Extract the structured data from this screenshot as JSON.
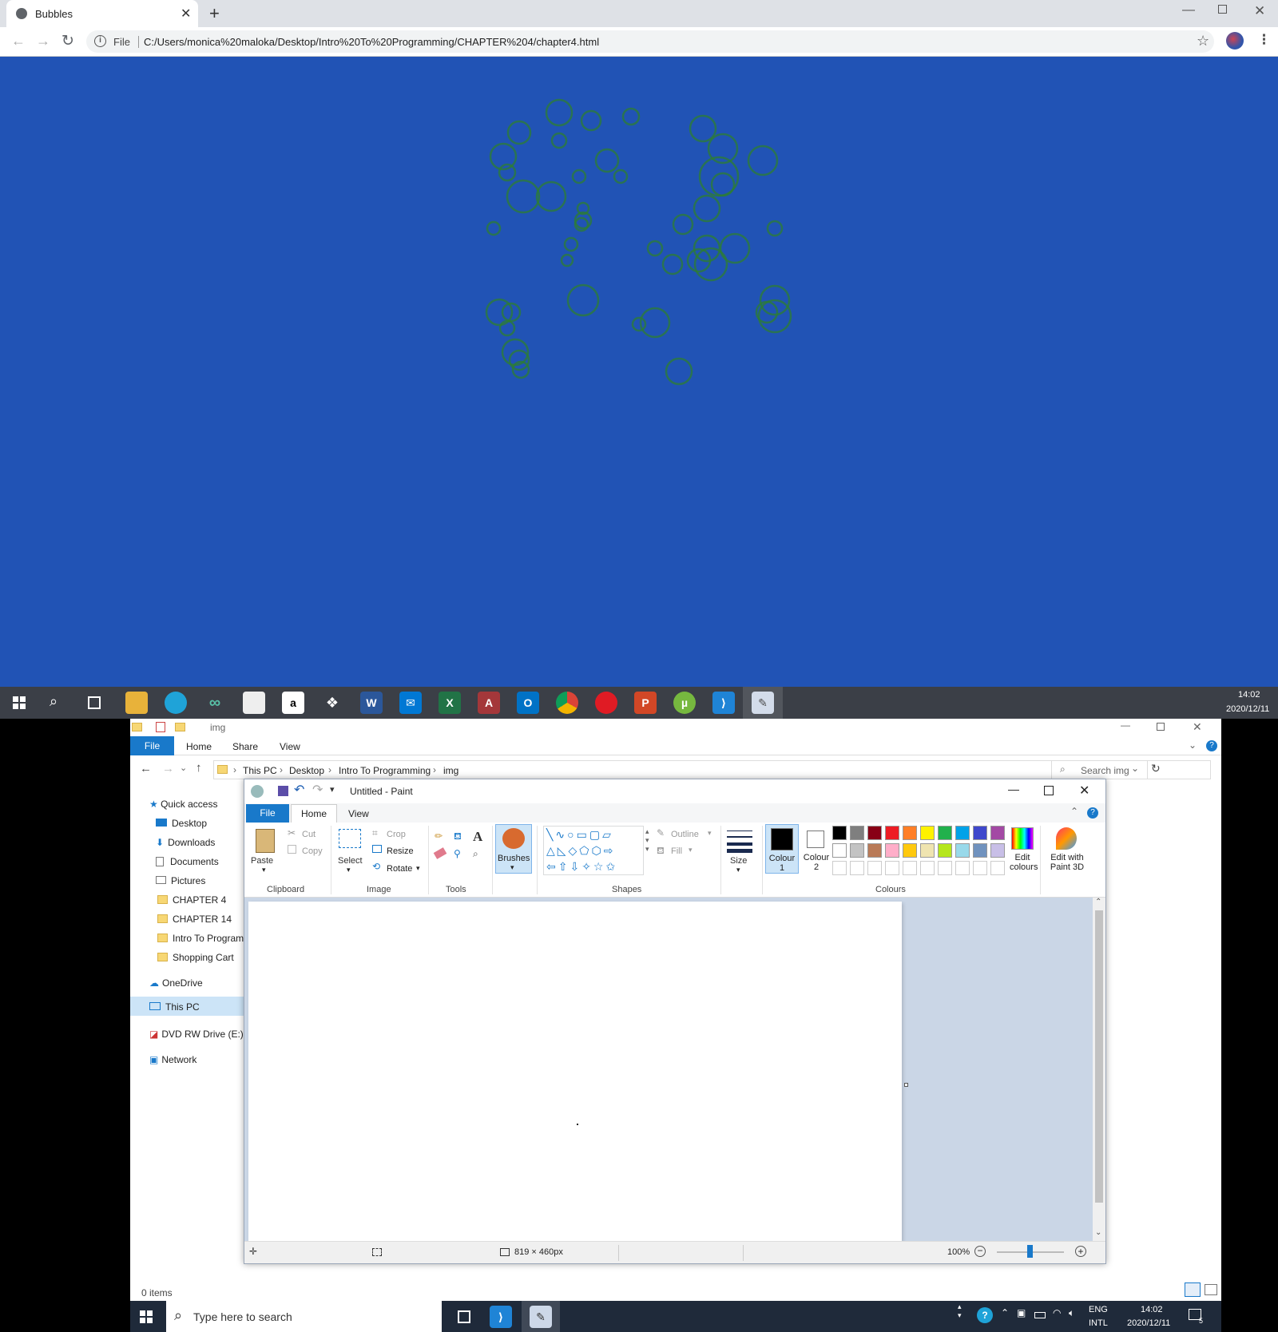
{
  "browser": {
    "tab_title": "Bubbles",
    "address_prefix": "File",
    "address": "C:/Users/monica%20maloka/Desktop/Intro%20To%20Programming/CHAPTER%204/chapter4.html",
    "bubble_color": "#2e7d32",
    "page_bg": "#2153b5"
  },
  "taskbar_top": {
    "time": "14:02",
    "date": "2020/12/11"
  },
  "explorer": {
    "title": "img",
    "tabs": [
      "File",
      "Home",
      "Share",
      "View"
    ],
    "breadcrumb": [
      "This PC",
      "Desktop",
      "Intro To Programming",
      "img"
    ],
    "search_placeholder": "Search img",
    "nav": {
      "quick_access": "Quick access",
      "desktop": "Desktop",
      "downloads": "Downloads",
      "documents": "Documents",
      "pictures": "Pictures",
      "ch4": "CHAPTER 4",
      "ch14": "CHAPTER 14",
      "intro": "Intro To Program",
      "cart": "Shopping Cart",
      "onedrive": "OneDrive",
      "thispc": "This PC",
      "dvd": "DVD RW Drive (E:)",
      "network": "Network"
    },
    "status": "0 items"
  },
  "paint": {
    "title": "Untitled - Paint",
    "tabs": [
      "File",
      "Home",
      "View"
    ],
    "clipboard": {
      "paste": "Paste",
      "cut": "Cut",
      "copy": "Copy",
      "group": "Clipboard"
    },
    "image": {
      "select": "Select",
      "crop": "Crop",
      "resize": "Resize",
      "rotate": "Rotate",
      "group": "Image"
    },
    "tools_group": "Tools",
    "brushes": "Brushes",
    "shapes": {
      "outline": "Outline",
      "fill": "Fill",
      "group": "Shapes"
    },
    "size": "Size",
    "colour1": "Colour 1",
    "colour2": "Colour 2",
    "colours_group": "Colours",
    "edit_colours": "Edit colours",
    "edit_3d": "Edit with Paint 3D",
    "palette_row1": [
      "#000000",
      "#7f7f7f",
      "#880015",
      "#ed1c24",
      "#ff7f27",
      "#fff200",
      "#22b14c",
      "#00a2e8",
      "#3f48cc",
      "#a349a4"
    ],
    "palette_row2": [
      "#ffffff",
      "#c3c3c3",
      "#b97a57",
      "#ffaec9",
      "#ffc90e",
      "#efe4b0",
      "#b5e61d",
      "#99d9ea",
      "#7092be",
      "#c8bfe7"
    ],
    "dimensions": "819 × 460px",
    "zoom": "100%"
  },
  "taskbar_bottom": {
    "search_placeholder": "Type here to search",
    "lang1": "ENG",
    "lang2": "INTL",
    "time": "14:02",
    "date": "2020/12/11",
    "notif_count": "5"
  }
}
